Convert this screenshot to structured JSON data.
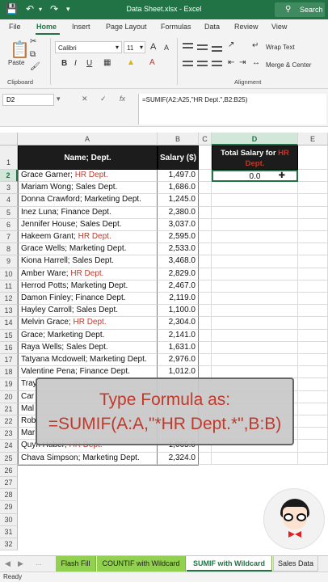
{
  "titlebar": {
    "title": "Data Sheet.xlsx  -  Excel",
    "search_label": "Search",
    "icons": [
      "save-icon",
      "undo-icon",
      "redo-icon",
      "customize-icon",
      "search-icon"
    ]
  },
  "ribbon_tabs": [
    "File",
    "Home",
    "Insert",
    "Page Layout",
    "Formulas",
    "Data",
    "Review",
    "View"
  ],
  "active_tab": "Home",
  "ribbon": {
    "paste_label": "Paste",
    "clipboard_label": "Clipboard",
    "font_name": "Calibri",
    "font_size": "11",
    "bold": "B",
    "italic": "I",
    "underline": "U",
    "grow_font": "A",
    "shrink_font": "A",
    "wrap_text": "Wrap Text",
    "merge_center": "Merge & Center",
    "alignment_label": "Alignment"
  },
  "formula_bar": {
    "name_box": "D2",
    "formula": "=SUMIF(A2:A25,\"HR Dept.\",B2:B25)"
  },
  "columns": [
    "A",
    "B",
    "C",
    "D",
    "E"
  ],
  "selected_column": "D",
  "selected_row": "2",
  "row_numbers": [
    "1",
    "2",
    "3",
    "4",
    "5",
    "6",
    "7",
    "8",
    "9",
    "10",
    "11",
    "12",
    "13",
    "14",
    "15",
    "16",
    "17",
    "18",
    "19",
    "20",
    "21",
    "22",
    "23",
    "24",
    "25",
    "26",
    "27",
    "28",
    "29",
    "30",
    "31",
    "32"
  ],
  "table": {
    "header_name": "Name; Dept.",
    "header_salary": "Salary ($)",
    "rows": [
      {
        "name": "Grace Garner; ",
        "dept": "HR Dept.",
        "hr": true,
        "salary": "1,497.0"
      },
      {
        "name": "Mariam Wong; ",
        "dept": "Sales Dept.",
        "hr": false,
        "salary": "1,686.0"
      },
      {
        "name": "Donna Crawford; ",
        "dept": "Marketing Dept.",
        "hr": false,
        "salary": "1,245.0"
      },
      {
        "name": "Inez Luna; ",
        "dept": "Finance Dept.",
        "hr": false,
        "salary": "2,380.0"
      },
      {
        "name": "Jennifer House; ",
        "dept": "Sales Dept.",
        "hr": false,
        "salary": "3,037.0"
      },
      {
        "name": "Hakeem Grant; ",
        "dept": "HR Dept.",
        "hr": true,
        "salary": "2,595.0"
      },
      {
        "name": "Grace Wells; ",
        "dept": "Marketing Dept.",
        "hr": false,
        "salary": "2,533.0"
      },
      {
        "name": "Kiona Harrell; ",
        "dept": "Sales Dept.",
        "hr": false,
        "salary": "3,468.0"
      },
      {
        "name": "Amber Ware; ",
        "dept": "HR Dept.",
        "hr": true,
        "salary": "2,829.0"
      },
      {
        "name": "Herrod Potts; ",
        "dept": "Marketing Dept.",
        "hr": false,
        "salary": "2,467.0"
      },
      {
        "name": "Damon Finley; ",
        "dept": "Finance Dept.",
        "hr": false,
        "salary": "2,119.0"
      },
      {
        "name": "Hayley Carroll; ",
        "dept": "Sales Dept.",
        "hr": false,
        "salary": "1,100.0"
      },
      {
        "name": "Melvin Grace; ",
        "dept": "HR Dept.",
        "hr": true,
        "salary": "2,304.0"
      },
      {
        "name": "Grace; ",
        "dept": "Marketing Dept.",
        "hr": false,
        "salary": "2,141.0"
      },
      {
        "name": "Raya Wells; ",
        "dept": "Sales Dept.",
        "hr": false,
        "salary": "1,631.0"
      },
      {
        "name": "Tatyana Mcdowell; ",
        "dept": "Marketing Dept.",
        "hr": false,
        "salary": "2,976.0"
      },
      {
        "name": "Valentine Pena; ",
        "dept": "Finance Dept.",
        "hr": false,
        "salary": "1,012.0"
      },
      {
        "name": "Tray",
        "dept": "",
        "hr": false,
        "salary": ""
      },
      {
        "name": "Car",
        "dept": "",
        "hr": false,
        "salary": ""
      },
      {
        "name": "Mal",
        "dept": "",
        "hr": false,
        "salary": ""
      },
      {
        "name": "Rob",
        "dept": "",
        "hr": false,
        "salary": ""
      },
      {
        "name": "Mar",
        "dept": "",
        "hr": false,
        "salary": ""
      },
      {
        "name": "Quyn Huber; ",
        "dept": "HR Dept.",
        "hr": true,
        "salary": "1,065.0"
      },
      {
        "name": "Chava Simpson; ",
        "dept": "Marketing Dept.",
        "hr": false,
        "salary": "2,324.0"
      }
    ]
  },
  "result": {
    "header_prefix": "Total Salary for ",
    "header_hr": "HR",
    "header_suffix": "Dept.",
    "value": "0.0"
  },
  "overlay": {
    "line1": "Type Formula as:",
    "line2": "=SUMIF(A:A,\"*HR Dept.*\",B:B)"
  },
  "sheet_tabs": [
    {
      "label": "Flash Fill",
      "state": "green"
    },
    {
      "label": "COUNTIF with Wildcard",
      "state": "green"
    },
    {
      "label": "SUMIF with Wildcard",
      "state": "active"
    },
    {
      "label": "Sales Data",
      "state": "plain"
    }
  ],
  "status": "Ready",
  "colors": {
    "excel_green": "#217346",
    "hr_red": "#c0392b",
    "header_black": "#1c1c1c",
    "tab_green": "#92d050"
  }
}
